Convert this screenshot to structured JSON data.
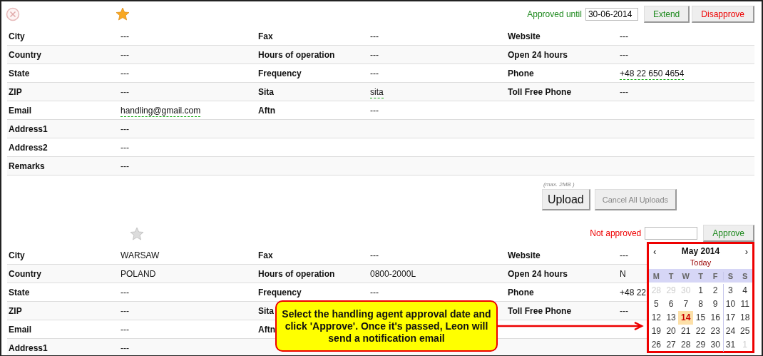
{
  "sections": [
    {
      "closable": true,
      "favorite": true,
      "status": {
        "text": "Approved until",
        "kind": "approved"
      },
      "date_field": {
        "value": "30-06-2014"
      },
      "buttons": [
        {
          "label": "Extend",
          "kind": "positive"
        },
        {
          "label": "Disapprove",
          "kind": "negative"
        }
      ],
      "rows": [
        [
          {
            "label": "City",
            "value": "---",
            "dashed": false
          },
          {
            "label": "Fax",
            "value": "---",
            "dashed": false
          },
          {
            "label": "Website",
            "value": "---",
            "dashed": false
          }
        ],
        [
          {
            "label": "Country",
            "value": "---",
            "dashed": false
          },
          {
            "label": "Hours of operation",
            "value": "---",
            "dashed": false
          },
          {
            "label": "Open 24 hours",
            "value": "---",
            "dashed": false
          }
        ],
        [
          {
            "label": "State",
            "value": "---",
            "dashed": false
          },
          {
            "label": "Frequency",
            "value": "---",
            "dashed": false
          },
          {
            "label": "Phone",
            "value": "+48 22 650 4654",
            "dashed": true
          }
        ],
        [
          {
            "label": "ZIP",
            "value": "---",
            "dashed": false
          },
          {
            "label": "Sita",
            "value": "sita",
            "dashed": true
          },
          {
            "label": "Toll Free Phone",
            "value": "---",
            "dashed": false
          }
        ],
        [
          {
            "label": "Email",
            "value": "handling@gmail.com",
            "dashed": true
          },
          {
            "label": "Aftn",
            "value": "---",
            "dashed": false
          }
        ],
        [
          {
            "label": "Address1",
            "value": "---",
            "dashed": false
          }
        ],
        [
          {
            "label": "Address2",
            "value": "---",
            "dashed": false
          }
        ],
        [
          {
            "label": "Remarks",
            "value": "---",
            "dashed": false
          }
        ]
      ],
      "upload": {
        "note": "(max. 2MB )",
        "buttons": [
          {
            "label": "Upload",
            "disabled": false
          },
          {
            "label": "Cancel All Uploads",
            "disabled": true
          }
        ]
      }
    },
    {
      "closable": false,
      "favorite": false,
      "status": {
        "text": "Not approved",
        "kind": "not_approved"
      },
      "buttons": [
        {
          "label": "Approve",
          "kind": "positive"
        }
      ],
      "rows": [
        [
          {
            "label": "City",
            "value": "WARSAW",
            "dashed": false
          },
          {
            "label": "Fax",
            "value": "---",
            "dashed": false
          },
          {
            "label": "Website",
            "value": "---",
            "dashed": false
          }
        ],
        [
          {
            "label": "Country",
            "value": "POLAND",
            "dashed": false
          },
          {
            "label": "Hours of operation",
            "value": "0800-2000L",
            "dashed": false
          },
          {
            "label": "Open 24 hours",
            "value": "N",
            "dashed": false
          }
        ],
        [
          {
            "label": "State",
            "value": "---",
            "dashed": false
          },
          {
            "label": "Frequency",
            "value": "---",
            "dashed": false
          },
          {
            "label": "Phone",
            "value": "+48 22",
            "dashed": false
          }
        ],
        [
          {
            "label": "ZIP",
            "value": "---",
            "dashed": false
          },
          {
            "label": "Sita"
          },
          {
            "label": "Toll Free Phone",
            "value": "---",
            "dashed": false
          }
        ],
        [
          {
            "label": "Email",
            "value": "---",
            "dashed": false
          },
          {
            "label": "Aftn"
          }
        ],
        [
          {
            "label": "Address1",
            "value": "---",
            "dashed": false
          }
        ]
      ]
    }
  ],
  "calendar": {
    "prev": "‹",
    "month": "May 2014",
    "next": "›",
    "today": "Today",
    "weekdays": [
      "M",
      "T",
      "W",
      "T",
      "F",
      "S",
      "S"
    ],
    "weeks": [
      [
        {
          "day": "28",
          "other_month": true,
          "selected": false
        },
        {
          "day": "29",
          "other_month": true,
          "selected": false
        },
        {
          "day": "30",
          "other_month": true,
          "selected": false
        },
        {
          "day": "1",
          "other_month": false,
          "selected": false
        },
        {
          "day": "2",
          "other_month": false,
          "selected": false
        },
        {
          "day": "3",
          "other_month": false,
          "selected": false
        },
        {
          "day": "4",
          "other_month": false,
          "selected": false
        }
      ],
      [
        {
          "day": "5",
          "other_month": false,
          "selected": false
        },
        {
          "day": "6",
          "other_month": false,
          "selected": false
        },
        {
          "day": "7",
          "other_month": false,
          "selected": false
        },
        {
          "day": "8",
          "other_month": false,
          "selected": false
        },
        {
          "day": "9",
          "other_month": false,
          "selected": false
        },
        {
          "day": "10",
          "other_month": false,
          "selected": false
        },
        {
          "day": "11",
          "other_month": false,
          "selected": false
        }
      ],
      [
        {
          "day": "12",
          "other_month": false,
          "selected": false
        },
        {
          "day": "13",
          "other_month": false,
          "selected": false
        },
        {
          "day": "14",
          "other_month": false,
          "selected": true
        },
        {
          "day": "15",
          "other_month": false,
          "selected": false
        },
        {
          "day": "16",
          "other_month": false,
          "selected": false
        },
        {
          "day": "17",
          "other_month": false,
          "selected": false
        },
        {
          "day": "18",
          "other_month": false,
          "selected": false
        }
      ],
      [
        {
          "day": "19",
          "other_month": false,
          "selected": false
        },
        {
          "day": "20",
          "other_month": false,
          "selected": false
        },
        {
          "day": "21",
          "other_month": false,
          "selected": false
        },
        {
          "day": "22",
          "other_month": false,
          "selected": false
        },
        {
          "day": "23",
          "other_month": false,
          "selected": false
        },
        {
          "day": "24",
          "other_month": false,
          "selected": false
        },
        {
          "day": "25",
          "other_month": false,
          "selected": false
        }
      ],
      [
        {
          "day": "26",
          "other_month": false,
          "selected": false
        },
        {
          "day": "27",
          "other_month": false,
          "selected": false
        },
        {
          "day": "28",
          "other_month": false,
          "selected": false
        },
        {
          "day": "29",
          "other_month": false,
          "selected": false
        },
        {
          "day": "30",
          "other_month": false,
          "selected": false
        },
        {
          "day": "31",
          "other_month": false,
          "selected": false
        },
        {
          "day": "1",
          "other_month": true,
          "selected": false
        }
      ]
    ]
  },
  "callout": {
    "text": "Select the handling agent approval date and click 'Approve'. Once it's passed, Leon will send a notification email"
  }
}
